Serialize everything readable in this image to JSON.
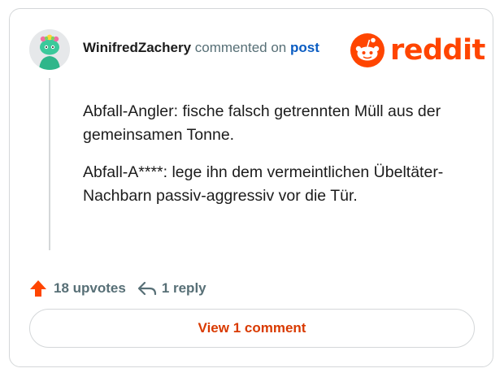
{
  "comment": {
    "username": "WinifredZachery",
    "action_text": "commented on",
    "post_link": "post",
    "paragraphs": [
      "Abfall-Angler: fische falsch getrennten Müll aus der gemeinsamen Tonne.",
      "Abfall-A****: lege ihn dem vermeintlichen Übeltäter-Nachbarn passiv-aggressiv vor die Tür."
    ]
  },
  "brand": {
    "name": "reddit",
    "icon": "reddit-snoo-icon",
    "color": "#ff4500"
  },
  "footer": {
    "upvotes_label": "18 upvotes",
    "upvote_icon": "upvote-arrow-icon",
    "upvote_color": "#ff4500",
    "replies_label": "1 reply",
    "reply_icon": "reply-icon"
  },
  "view_button": {
    "label": "View 1 comment",
    "color": "#d93a00"
  },
  "avatar": {
    "icon": "snoo-avatar-icon"
  }
}
